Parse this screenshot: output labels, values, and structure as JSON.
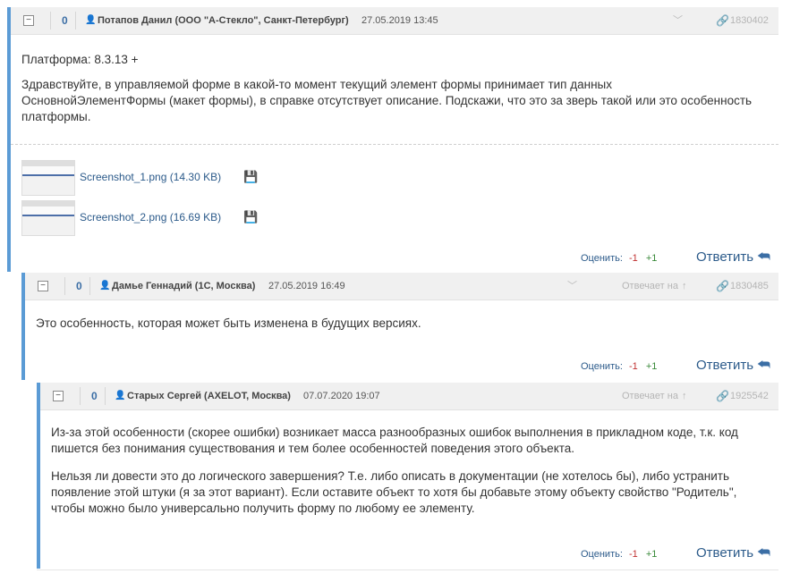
{
  "posts": [
    {
      "score": "0",
      "author": "Потапов Данил (ООО \"А-Стекло\", Санкт-Петербург)",
      "date": "27.05.2019 13:45",
      "post_id": "1830402",
      "platform": "Платформа: 8.3.13 +",
      "body": "Здравствуйте, в управляемой форме в какой-то момент текущий элемент формы принимает тип данных ОсновнойЭлементФормы (макет формы), в справке отсутствует описание. Подскажи, что это за зверь такой или это особенность платформы.",
      "attachments": [
        {
          "name": "Screenshot_1.png (14.30 KB)"
        },
        {
          "name": "Screenshot_2.png (16.69 KB)"
        }
      ],
      "rate_label": "Оценить:",
      "minus": "-1",
      "plus": "+1",
      "reply_label": "Ответить"
    },
    {
      "score": "0",
      "author": "Дамье Геннадий (1С, Москва)",
      "date": "27.05.2019 16:49",
      "reply_to_label": "Отвечает на",
      "post_id": "1830485",
      "body": "Это особенность, которая может быть изменена в будущих версиях.",
      "rate_label": "Оценить:",
      "minus": "-1",
      "plus": "+1",
      "reply_label": "Ответить"
    },
    {
      "score": "0",
      "author": "Старых Сергей (AXELOT, Москва)",
      "date": "07.07.2020 19:07",
      "reply_to_label": "Отвечает на",
      "post_id": "1925542",
      "body_p1": "Из-за этой особенности (скорее ошибки) возникает масса разнообразных ошибок выполнения в прикладном коде, т.к. код пишется без понимания существования и тем более особенностей поведения этого объекта.",
      "body_p2": "Нельзя ли довести это до логического завершения? Т.е. либо описать  в документации (не хотелось бы), либо устранить появление этой штуки (я за этот вариант). Если оставите объект то хотя бы добавьте этому объекту свойство \"Родитель\", чтобы можно было универсально получить форму по любому ее элементу.",
      "rate_label": "Оценить:",
      "minus": "-1",
      "plus": "+1",
      "reply_label": "Ответить"
    }
  ],
  "icons": {
    "collapse": "⊟",
    "person": "person-icon",
    "chevron": "chevron-down-icon",
    "reply_to_arrow": "arrow-up-icon",
    "link": "link-icon",
    "save": "floppy-disk-icon",
    "reply_back": "reply-arrow-icon"
  },
  "colors": {
    "accent_bar": "#5b9bd5",
    "header_bg": "#f0f0f0",
    "link": "#2b5a8a",
    "minus": "#c03030",
    "plus": "#3a8a3a"
  }
}
